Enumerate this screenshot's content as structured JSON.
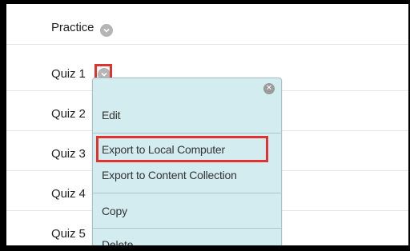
{
  "items": [
    {
      "label": "Practice"
    },
    {
      "label": "Quiz 1"
    },
    {
      "label": "Quiz 2"
    },
    {
      "label": "Quiz 3"
    },
    {
      "label": "Quiz 4"
    },
    {
      "label": "Quiz 5"
    }
  ],
  "menu": {
    "edit": "Edit",
    "export_local": "Export to Local Computer",
    "export_collection": "Export to Content Collection",
    "copy": "Copy",
    "delete": "Delete"
  },
  "colors": {
    "highlight": "#e0322e",
    "menu_bg": "#d3ecf0",
    "chevron": "#b5b5b5"
  }
}
